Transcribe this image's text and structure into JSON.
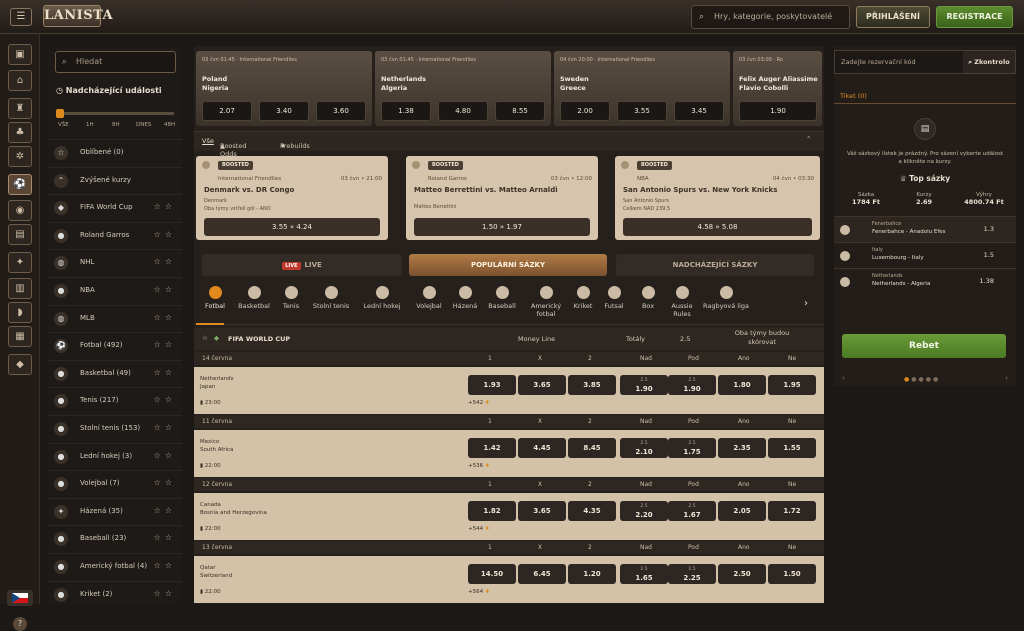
{
  "header": {
    "logo": "LANISTA",
    "search_placeholder": "Hry, kategorie, poskytovatelé",
    "login": "PŘIHLÁŠENÍ",
    "register": "REGISTRACE"
  },
  "sidebar": {
    "search_placeholder": "Hledat",
    "upcoming": "Nadcházející události",
    "time_labels": [
      "VŠE",
      "1H",
      "8H",
      "DNES",
      "48H"
    ],
    "items": [
      {
        "label": "Oblíbené (0)",
        "stars": false
      },
      {
        "label": "Zvýšené kurzy",
        "stars": false
      },
      {
        "label": "FIFA World Cup",
        "stars": true
      },
      {
        "label": "Roland Garros",
        "stars": true
      },
      {
        "label": "NHL",
        "stars": true
      },
      {
        "label": "NBA",
        "stars": true
      },
      {
        "label": "MLB",
        "stars": true
      },
      {
        "label": "Fotbal (492)",
        "stars": true
      },
      {
        "label": "Basketbal (49)",
        "stars": true
      },
      {
        "label": "Tenis (217)",
        "stars": true
      },
      {
        "label": "Stolní tenis (153)",
        "stars": true
      },
      {
        "label": "Lední hokej (3)",
        "stars": true
      },
      {
        "label": "Volejbal (7)",
        "stars": true
      },
      {
        "label": "Házená (35)",
        "stars": true
      },
      {
        "label": "Baseball (23)",
        "stars": true
      },
      {
        "label": "Americký fotbal (4)",
        "stars": true
      },
      {
        "label": "Kriket (2)",
        "stars": true
      }
    ]
  },
  "tickets": [
    {
      "head": "03 čvn 01:45  ·  International Friendlies",
      "t1": "Poland",
      "t2": "Nigeria",
      "odds": [
        "2.07",
        "3.40",
        "3.60"
      ]
    },
    {
      "head": "03 čvn 01:45  ·  International Friendlies",
      "t1": "Netherlands",
      "t2": "Algeria",
      "odds": [
        "1.38",
        "4.80",
        "8.55"
      ]
    },
    {
      "head": "04 čvn 20:00  ·  International Friendlies",
      "t1": "Sweden",
      "t2": "Greece",
      "odds": [
        "2.00",
        "3.55",
        "3.45"
      ]
    },
    {
      "head": "03 čvn 03:00  ·  Ro",
      "t1": "Felix Auger Aliassime",
      "t2": "Flavio Cobolli",
      "odds": [
        "1.90"
      ]
    }
  ],
  "filters": [
    "Vše",
    "Boosted Odds",
    "Prebuilds"
  ],
  "boosted": [
    {
      "tag": "BOOSTED",
      "league": "International Friendlies",
      "date": "03 čvn • 21:00",
      "title": "Denmark vs. DR Congo",
      "sub1": "Denmark",
      "sub2": "Oba týmy vstřelí gól - ANO",
      "odds": "3.55 » 4.24"
    },
    {
      "tag": "BOOSTED",
      "league": "Roland Garros",
      "date": "03 čvn • 12:00",
      "title": "Matteo Berrettini vs. Matteo Arnaldi",
      "sub1": "Matteo Berrettini",
      "sub2": "",
      "odds": "1.50 » 1.97"
    },
    {
      "tag": "BOOSTED",
      "league": "NBA",
      "date": "04 čvn • 03:30",
      "title": "San Antonio Spurs vs. New York Knicks",
      "sub1": "San Antonio Spurs",
      "sub2": "Celkem NAD 239.5",
      "odds": "4.58 » 5.08"
    }
  ],
  "tabs": {
    "live": "LIVE",
    "popular": "POPULÁRNÍ SÁZKY",
    "upcoming": "NADCHÁZEJÍCÍ SÁZKY"
  },
  "sports": [
    "Fotbal",
    "Basketbal",
    "Tenis",
    "Stolní tenis",
    "Lední hokej",
    "Volejbal",
    "Házená",
    "Baseball",
    "Americký fotbal",
    "Kriket",
    "Futsal",
    "Box",
    "Aussie Rules",
    "Ragbyová liga"
  ],
  "section": {
    "title": "FIFA WORLD CUP",
    "moneyline": "Money Line",
    "totals": "Totály",
    "total_line": "2.5",
    "btts": "Oba týmy budou skórovat"
  },
  "columns": [
    "1",
    "X",
    "2",
    "Nad",
    "Pod",
    "Ano",
    "Ne"
  ],
  "days": [
    {
      "date": "14 června",
      "match": {
        "t1": "Netherlands",
        "t2": "Japan",
        "time": "23:00",
        "more": "+542",
        "odds": [
          "1.93",
          "3.65",
          "3.85",
          "1.90",
          "1.90",
          "1.80",
          "1.95"
        ]
      }
    },
    {
      "date": "11 června",
      "match": {
        "t1": "Mexico",
        "t2": "South Africa",
        "time": "22:00",
        "more": "+536",
        "odds": [
          "1.42",
          "4.45",
          "8.45",
          "2.10",
          "1.75",
          "2.35",
          "1.55"
        ]
      }
    },
    {
      "date": "12 června",
      "match": {
        "t1": "Canada",
        "t2": "Bosnia and Herzegovina",
        "time": "22:00",
        "more": "+544",
        "odds": [
          "1.82",
          "3.65",
          "4.35",
          "2.20",
          "1.67",
          "2.05",
          "1.72"
        ]
      }
    },
    {
      "date": "13 června",
      "match": {
        "t1": "Qatar",
        "t2": "Switzerland",
        "time": "22:00",
        "more": "+564",
        "odds": [
          "14.50",
          "6.45",
          "1.20",
          "1.65",
          "2.25",
          "2.50",
          "1.50"
        ]
      }
    }
  ],
  "right": {
    "placeholder": "Zadejte rezervační kód",
    "check": "Zkontrolo",
    "tab": "Tiket (0)",
    "empty": "Váš sázkový lístek je prázdný. Pro sázení vyberte událost a klikněte na kurzy.",
    "top": "Top sázky",
    "stake_l": "Sázka",
    "stake_v": "1784 Ft",
    "odds_l": "Kurzy",
    "odds_v": "2.69",
    "win_l": "Výhry",
    "win_v": "4800.74 Ft",
    "bets": [
      {
        "t1": "Fenerbahce",
        "t2": "Fenerbahce - Anadolu Efes",
        "o": "1.3"
      },
      {
        "t1": "Italy",
        "t2": "Luxembourg - Italy",
        "o": "1.5"
      },
      {
        "t1": "Netherlands",
        "t2": "Netherlands - Algeria",
        "o": "1.38"
      }
    ],
    "rebet": "Rebet"
  }
}
